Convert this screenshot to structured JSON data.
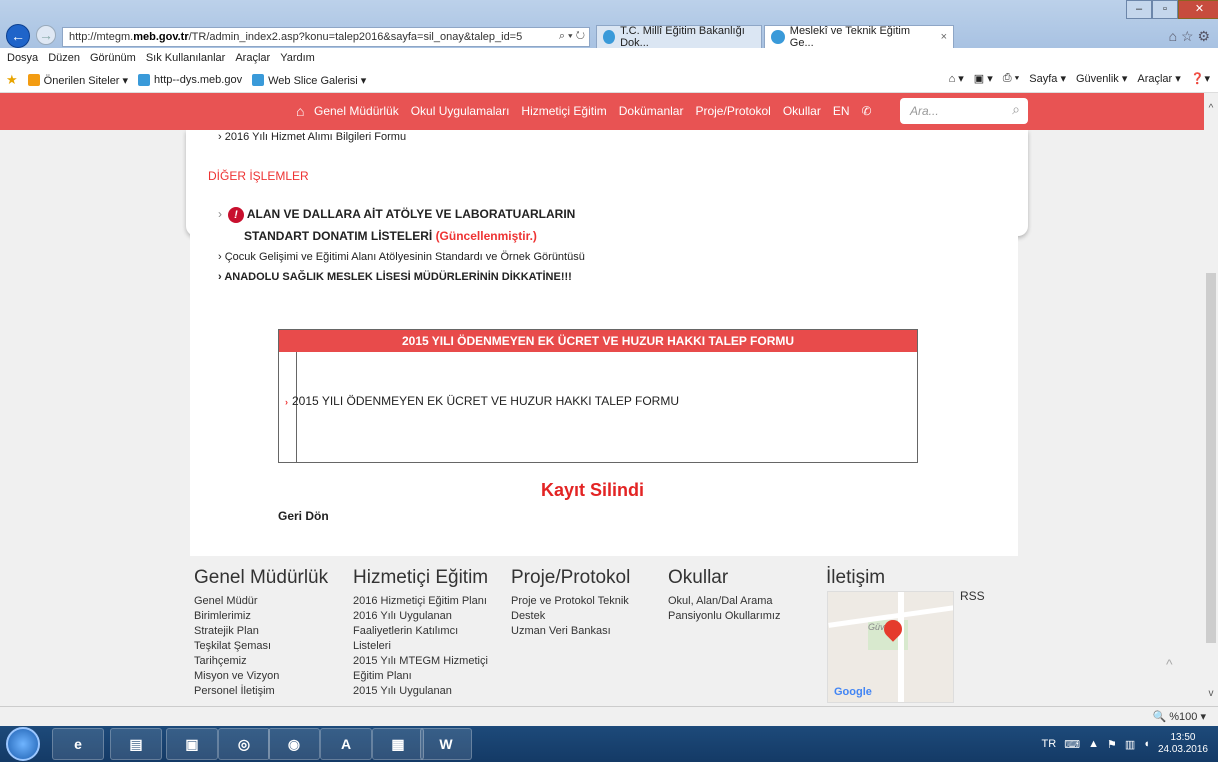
{
  "browser": {
    "address": "http://mtegm.meb.gov.tr/TR/admin_index2.asp?konu=talep2016&sayfa=sil_onay&talep_id=5",
    "address_prefix": "http://mtegm.",
    "address_domain": "meb.gov.tr",
    "address_suffix": "/TR/admin_index2.asp?konu=talep2016&sayfa=sil_onay&talep_id=5",
    "address_controls": "⌕ ▾ ↻",
    "tabs": [
      {
        "label": "T.C. Millî Eğitim Bakanlığı Dok..."
      },
      {
        "label": "Meslekî ve Teknik Eğitim Ge..."
      }
    ],
    "menu": [
      "Dosya",
      "Düzen",
      "Görünüm",
      "Sık Kullanılanlar",
      "Araçlar",
      "Yardım"
    ],
    "favorites": [
      "Önerilen Siteler ▾",
      "http--dys.meb.gov",
      "Web Slice Galerisi ▾"
    ],
    "command_bar": [
      "Sayfa ▾",
      "Güvenlik ▾",
      "Araçlar ▾"
    ],
    "zoom": "%100"
  },
  "site_nav": {
    "links": [
      "Genel Müdürlük",
      "Okul Uygulamaları",
      "Hizmetiçi Eğitim",
      "Dokümanlar",
      "Proje/Protokol",
      "Okullar",
      "EN"
    ],
    "search_placeholder": "Ara..."
  },
  "content": {
    "top_item": "2016 Yılı Hizmet Alımı Bilgileri Formu",
    "section_title": "DİĞER İŞLEMLER",
    "items": [
      {
        "line1": "ALAN VE DALLARA AİT ATÖLYE VE LABORATUARLARIN",
        "line2": "STANDART DONATIM LİSTELERİ",
        "tag": "(Güncellenmiştir.)"
      },
      {
        "label": "Çocuk Gelişimi ve Eğitimi Alanı Atölyesinin Standardı ve Örnek Görüntüsü"
      },
      {
        "label": "ANADOLU SAĞLIK MESLEK LİSESİ MÜDÜRLERİNİN DİKKATİNE!!!"
      }
    ],
    "form_title": "2015 YILI ÖDENMEYEN EK ÜCRET VE HUZUR HAKKI TALEP FORMU",
    "form_item": "2015 YILI ÖDENMEYEN EK ÜCRET VE HUZUR HAKKI TALEP FORMU",
    "status": "Kayıt Silindi",
    "back": "Geri Dön"
  },
  "footer": {
    "columns": [
      {
        "title": "Genel Müdürlük",
        "items": [
          "Genel Müdür",
          "Birimlerimiz",
          "Stratejik Plan",
          "Teşkilat Şeması",
          "Tarihçemiz",
          "Misyon ve Vizyon",
          "Personel İletişim"
        ]
      },
      {
        "title": "Hizmetiçi Eğitim",
        "items": [
          "2016 Hizmetiçi Eğitim Planı",
          "2016 Yılı Uygulanan",
          "Faaliyetlerin Katılımcı",
          "Listeleri",
          "2015 Yılı MTEGM Hizmetiçi",
          "Eğitim Planı",
          "2015 Yılı Uygulanan"
        ]
      },
      {
        "title": "Proje/Protokol",
        "items": [
          "Proje ve Protokol Teknik",
          "Destek",
          "Uzman Veri Bankası"
        ]
      },
      {
        "title": "Okullar",
        "items": [
          "Okul, Alan/Dal Arama",
          "Pansiyonlu Okullarımız"
        ]
      },
      {
        "title": "İletişim",
        "items": []
      }
    ],
    "rss": "RSS",
    "map_label": "Güv",
    "map_brand": "Google"
  },
  "taskbar": {
    "lang": "TR",
    "time": "13:50",
    "date": "24.03.2016"
  }
}
